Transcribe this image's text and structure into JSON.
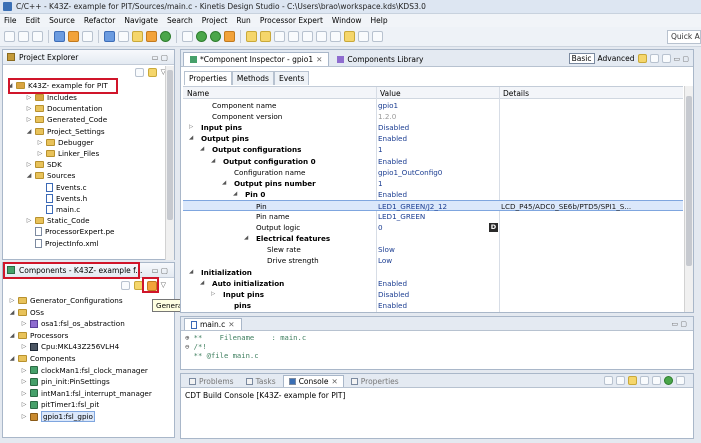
{
  "window": {
    "title": "C/C++ - K43Z- example for PIT/Sources/main.c - Kinetis Design Studio - C:\\Users\\brao\\workspace.kds\\KDS3.0"
  },
  "menu": [
    "File",
    "Edit",
    "Source",
    "Refactor",
    "Navigate",
    "Search",
    "Project",
    "Run",
    "Processor Expert",
    "Window",
    "Help"
  ],
  "quick_access": "Quick A",
  "project_explorer": {
    "title": "Project Explorer",
    "project": "K43Z- example for PIT",
    "items": [
      {
        "label": "Includes",
        "depth": 1,
        "icon": "includes-icon"
      },
      {
        "label": "Documentation",
        "depth": 1,
        "icon": "folder-icon"
      },
      {
        "label": "Generated_Code",
        "depth": 1,
        "icon": "folder-icon"
      },
      {
        "label": "Project_Settings",
        "depth": 1,
        "icon": "folder-icon"
      },
      {
        "label": "Debugger",
        "depth": 2,
        "icon": "folder-icon"
      },
      {
        "label": "Linker_Files",
        "depth": 2,
        "icon": "folder-icon"
      },
      {
        "label": "SDK",
        "depth": 1,
        "icon": "folder-icon"
      },
      {
        "label": "Sources",
        "depth": 1,
        "icon": "folder-icon"
      },
      {
        "label": "Events.c",
        "depth": 2,
        "icon": "c-file-icon"
      },
      {
        "label": "Events.h",
        "depth": 2,
        "icon": "h-file-icon"
      },
      {
        "label": "main.c",
        "depth": 2,
        "icon": "c-file-icon"
      },
      {
        "label": "Static_Code",
        "depth": 1,
        "icon": "folder-icon"
      },
      {
        "label": "ProcessorExpert.pe",
        "depth": 1,
        "icon": "pe-file-icon"
      },
      {
        "label": "ProjectInfo.xml",
        "depth": 1,
        "icon": "xml-file-icon"
      }
    ]
  },
  "components": {
    "title": "Components - K43Z- example f...",
    "tooltip": "Generate Processor Expert Code",
    "items": [
      {
        "label": "Generator_Configurations",
        "depth": 0
      },
      {
        "label": "OSs",
        "depth": 0
      },
      {
        "label": "osa1:fsl_os_abstraction",
        "depth": 1
      },
      {
        "label": "Processors",
        "depth": 0
      },
      {
        "label": "Cpu:MKL43Z256VLH4",
        "depth": 1
      },
      {
        "label": "Components",
        "depth": 0
      },
      {
        "label": "clockMan1:fsl_clock_manager",
        "depth": 1
      },
      {
        "label": "pin_init:PinSettings",
        "depth": 1
      },
      {
        "label": "intMan1:fsl_interrupt_manager",
        "depth": 1
      },
      {
        "label": "pitTimer1:fsl_pit",
        "depth": 1
      },
      {
        "label": "gpio1:fsl_gpio",
        "depth": 1
      }
    ]
  },
  "inspector": {
    "tab_title": "*Component Inspector - gpio1",
    "lib_tab": "Components Library",
    "mode_basic": "Basic",
    "mode_advanced": "Advanced",
    "subtabs": [
      "Properties",
      "Methods",
      "Events"
    ],
    "columns": [
      "Name",
      "Value",
      "Details"
    ],
    "rows": [
      {
        "name": "Component name",
        "value": "gpio1",
        "details": "",
        "indent": 1,
        "twist": ""
      },
      {
        "name": "Component version",
        "value": "1.2.0",
        "details": "",
        "indent": 1,
        "twist": "",
        "grey": true
      },
      {
        "name": "Input pins",
        "value": "Disabled",
        "details": "",
        "indent": 0,
        "twist": "▷",
        "bold": true
      },
      {
        "name": "Output pins",
        "value": "Enabled",
        "details": "",
        "indent": 0,
        "twist": "◢",
        "bold": true
      },
      {
        "name": "Output configurations",
        "value": "1",
        "details": "",
        "indent": 1,
        "twist": "◢",
        "bold": true
      },
      {
        "name": "Output configuration 0",
        "value": "Enabled",
        "details": "",
        "indent": 2,
        "twist": "◢",
        "bold": true
      },
      {
        "name": "Configuration name",
        "value": "gpio1_OutConfig0",
        "details": "",
        "indent": 3,
        "twist": ""
      },
      {
        "name": "Output pins number",
        "value": "1",
        "details": "",
        "indent": 3,
        "twist": "◢",
        "bold": true
      },
      {
        "name": "Pin 0",
        "value": "Enabled",
        "details": "",
        "indent": 4,
        "twist": "◢",
        "bold": true
      },
      {
        "name": "Pin",
        "value": "LED1_GREEN/J2_12",
        "details": "LCD_P45/ADC0_SE6b/PTD5/SPI1_S...",
        "indent": 5,
        "twist": "",
        "selected": true
      },
      {
        "name": "Pin name",
        "value": "LED1_GREEN",
        "details": "",
        "indent": 5,
        "twist": ""
      },
      {
        "name": "Output logic",
        "value": "0",
        "details": "",
        "indent": 5,
        "twist": "",
        "badge": "D"
      },
      {
        "name": "Electrical features",
        "value": "",
        "details": "",
        "indent": 5,
        "twist": "◢",
        "bold": true
      },
      {
        "name": "Slew rate",
        "value": "Slow",
        "details": "",
        "indent": 6,
        "twist": ""
      },
      {
        "name": "Drive strength",
        "value": "Low",
        "details": "",
        "indent": 6,
        "twist": ""
      },
      {
        "name": "Initialization",
        "value": "",
        "details": "",
        "indent": 0,
        "twist": "◢",
        "bold": true
      },
      {
        "name": "Auto initialization",
        "value": "Enabled",
        "details": "",
        "indent": 1,
        "twist": "◢",
        "bold": true
      },
      {
        "name": "Input pins",
        "value": "Disabled",
        "details": "",
        "indent": 2,
        "twist": "▷",
        "bold": true
      },
      {
        "name": "pins",
        "value": "Enabled",
        "details": "",
        "indent": 3,
        "twist": "",
        "bold": true
      }
    ]
  },
  "editor": {
    "tab": "main.c",
    "lines": [
      "**    Filename    : main.c",
      "/*!",
      "** @file main.c"
    ]
  },
  "console": {
    "tabs": [
      "Problems",
      "Tasks",
      "Console",
      "Properties"
    ],
    "text": "CDT Build Console [K43Z- example for PIT]"
  }
}
